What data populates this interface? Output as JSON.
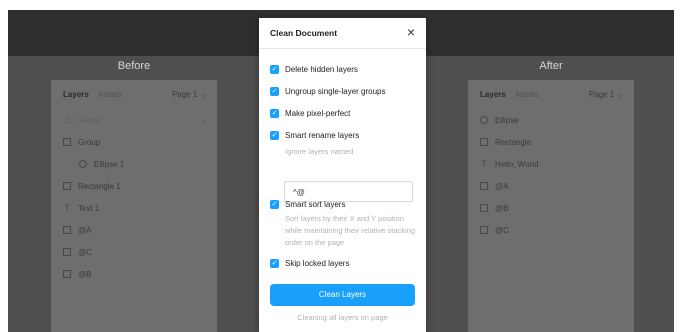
{
  "before": {
    "heading": "Before",
    "tabs": {
      "layers": "Layers",
      "assets": "Assets"
    },
    "page": "Page 1",
    "layers": [
      {
        "label": "Vector",
        "icon": "vector-icon",
        "dim": true
      },
      {
        "label": "Group",
        "icon": "frame-icon"
      },
      {
        "label": "Ellipse 1",
        "icon": "ellipse-icon"
      },
      {
        "label": "Rectangle 1",
        "icon": "frame-icon"
      },
      {
        "label": "Text 1",
        "icon": "text-icon"
      },
      {
        "label": "@A",
        "icon": "frame-icon"
      },
      {
        "label": "@C",
        "icon": "frame-icon"
      },
      {
        "label": "@B",
        "icon": "frame-icon"
      }
    ]
  },
  "after": {
    "heading": "After",
    "tabs": {
      "layers": "Layers",
      "assets": "Assets"
    },
    "page": "Page 1",
    "layers": [
      {
        "label": "Ellipse",
        "icon": "ellipse-icon"
      },
      {
        "label": "Rectangle",
        "icon": "frame-icon"
      },
      {
        "label": "Hello, World",
        "icon": "text-icon"
      },
      {
        "label": "@A",
        "icon": "frame-icon"
      },
      {
        "label": "@B",
        "icon": "frame-icon"
      },
      {
        "label": "@C",
        "icon": "frame-icon"
      }
    ]
  },
  "modal": {
    "title": "Clean Document",
    "options": {
      "delete_hidden": "Delete hidden layers",
      "ungroup_single": "Ungroup single-layer groups",
      "pixel_perfect": "Make pixel-perfect",
      "smart_rename": "Smart rename layers",
      "smart_sort": "Smart sort layers",
      "skip_locked": "Skip locked layers"
    },
    "ignore_label": "Ignore layers named",
    "ignore_value": "^@",
    "sort_description": "Sort layers by their X and Y position while maintaining their relative stacking order on the page",
    "primary_button": "Clean Layers",
    "footer": "Cleaning all layers on page"
  },
  "colors": {
    "accent": "#18a0fb"
  }
}
